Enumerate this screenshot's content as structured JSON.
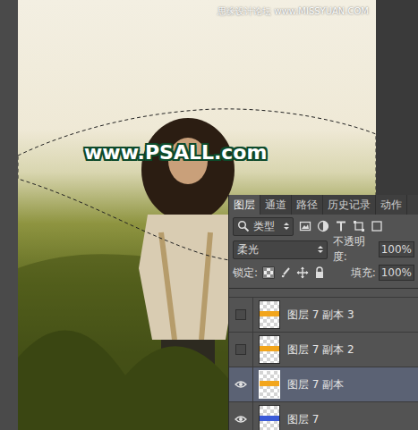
{
  "watermarks": {
    "site": "思缘设计论坛 www.MISSYUAN.COM",
    "overlay": "www.PSALL.com"
  },
  "panel": {
    "tabs": [
      {
        "label": "图层",
        "selected": true
      },
      {
        "label": "通道",
        "selected": false
      },
      {
        "label": "路径",
        "selected": false
      },
      {
        "label": "历史记录",
        "selected": false
      },
      {
        "label": "动作",
        "selected": false
      }
    ],
    "filter": {
      "label": "类型"
    },
    "blend_mode": "柔光",
    "opacity": {
      "label": "不透明度:",
      "value": "100%"
    },
    "lock": {
      "label": "锁定:"
    },
    "fill": {
      "label": "填充:",
      "value": "100%"
    },
    "layers": [
      {
        "name": "图层 7 副本 3",
        "visible": false,
        "selected": false,
        "color": "#f2a51c"
      },
      {
        "name": "图层 7 副本 2",
        "visible": false,
        "selected": false,
        "color": "#f2a51c"
      },
      {
        "name": "图层 7 副本",
        "visible": true,
        "selected": true,
        "color": "#f2a51c"
      },
      {
        "name": "图层 7",
        "visible": true,
        "selected": false,
        "color": "#3b5bd8"
      }
    ]
  }
}
